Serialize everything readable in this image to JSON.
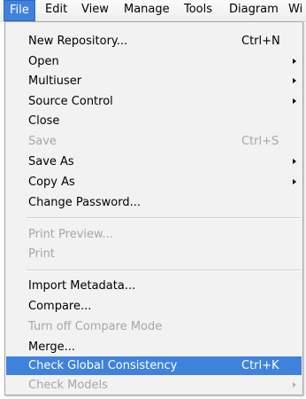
{
  "menubar": {
    "items": [
      "File",
      "Edit",
      "View",
      "Manage",
      "Tools",
      "Diagram",
      "Wi"
    ]
  },
  "file_menu": {
    "items": [
      {
        "label": "New Repository...",
        "shortcut": "Ctrl+N"
      },
      {
        "label": "Open"
      },
      {
        "label": "Multiuser"
      },
      {
        "label": "Source Control"
      },
      {
        "label": "Close"
      },
      {
        "label": "Save",
        "shortcut": "Ctrl+S"
      },
      {
        "label": "Save As"
      },
      {
        "label": "Copy As"
      },
      {
        "label": "Change Password..."
      },
      {
        "label": "Print Preview..."
      },
      {
        "label": "Print"
      },
      {
        "label": "Import Metadata..."
      },
      {
        "label": "Compare..."
      },
      {
        "label": "Turn off Compare Mode"
      },
      {
        "label": "Merge..."
      },
      {
        "label": "Check Global Consistency",
        "shortcut": "Ctrl+K"
      },
      {
        "label": "Check Models"
      }
    ]
  },
  "colors": {
    "highlight": "#3f82dc",
    "disabled_text": "#a6a6a6",
    "menu_background": "#f2f2f2"
  }
}
